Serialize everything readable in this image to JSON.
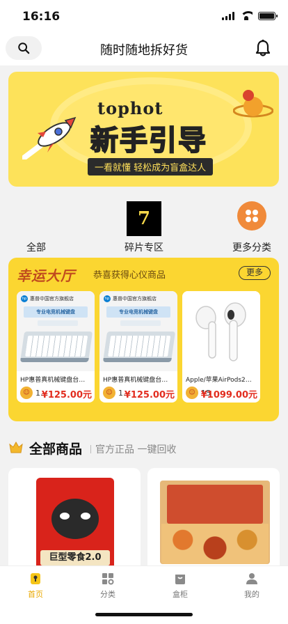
{
  "status_bar": {
    "time": "16:16"
  },
  "header": {
    "title": "随时随地拆好货"
  },
  "banner": {
    "brand": "tophot",
    "title": "新手引导",
    "subtitle": "一看就懂 轻松成为盲盒达人"
  },
  "categories": [
    {
      "label": "全部"
    },
    {
      "label": "碎片专区",
      "tile_text": "7"
    },
    {
      "label": "更多分类"
    }
  ],
  "lucky_hall": {
    "title": "幸运大厅",
    "subtitle": "恭喜获得心仪商品",
    "more_label": "更多",
    "cards": [
      {
        "store": "惠普中国官方旗舰店",
        "banner_text": "专业电竞机械键盘",
        "name": "HP惠普真机械键盘台式电...",
        "count": "1...",
        "price": "¥125.00元"
      },
      {
        "store": "惠普中国官方旗舰店",
        "banner_text": "专业电竞机械键盘",
        "name": "HP惠普真机械键盘台式电...",
        "count": "1...",
        "price": "¥125.00元"
      },
      {
        "name": "Apple/苹果AirPods2代(配...",
        "count": "15",
        "price": "¥1099.00元"
      }
    ]
  },
  "all_products": {
    "title": "全部商品",
    "subtitle": "官方正品 一键回收",
    "items": [
      {
        "label": "巨型零食2.0"
      },
      {
        "label": ""
      }
    ]
  },
  "tabbar": {
    "tabs": [
      {
        "label": "首页",
        "active": true
      },
      {
        "label": "分类"
      },
      {
        "label": "盒柜"
      },
      {
        "label": "我的"
      }
    ]
  },
  "colors": {
    "accent": "#fbd631",
    "price": "#e22d1f",
    "tab_active": "#e9a800",
    "more_circle": "#f08a3a"
  }
}
